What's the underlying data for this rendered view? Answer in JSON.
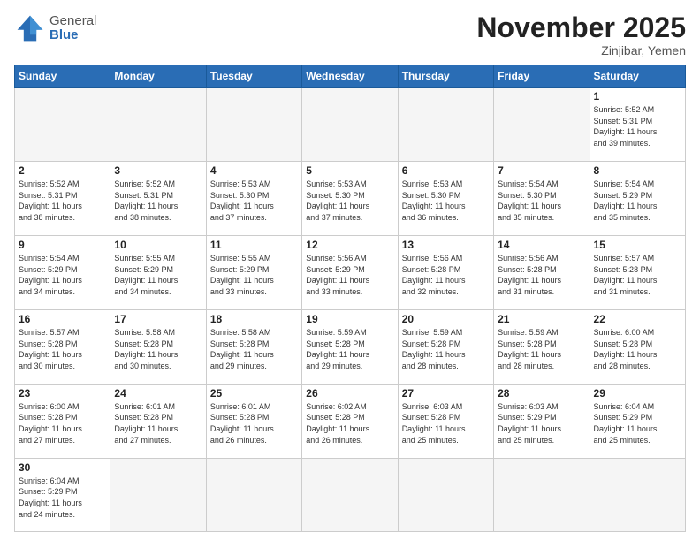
{
  "header": {
    "logo_general": "General",
    "logo_blue": "Blue",
    "month_title": "November 2025",
    "location": "Zinjibar, Yemen"
  },
  "weekdays": [
    "Sunday",
    "Monday",
    "Tuesday",
    "Wednesday",
    "Thursday",
    "Friday",
    "Saturday"
  ],
  "weeks": [
    [
      {
        "day": "",
        "info": ""
      },
      {
        "day": "",
        "info": ""
      },
      {
        "day": "",
        "info": ""
      },
      {
        "day": "",
        "info": ""
      },
      {
        "day": "",
        "info": ""
      },
      {
        "day": "",
        "info": ""
      },
      {
        "day": "1",
        "info": "Sunrise: 5:52 AM\nSunset: 5:31 PM\nDaylight: 11 hours\nand 39 minutes."
      }
    ],
    [
      {
        "day": "2",
        "info": "Sunrise: 5:52 AM\nSunset: 5:31 PM\nDaylight: 11 hours\nand 38 minutes."
      },
      {
        "day": "3",
        "info": "Sunrise: 5:52 AM\nSunset: 5:31 PM\nDaylight: 11 hours\nand 38 minutes."
      },
      {
        "day": "4",
        "info": "Sunrise: 5:53 AM\nSunset: 5:30 PM\nDaylight: 11 hours\nand 37 minutes."
      },
      {
        "day": "5",
        "info": "Sunrise: 5:53 AM\nSunset: 5:30 PM\nDaylight: 11 hours\nand 37 minutes."
      },
      {
        "day": "6",
        "info": "Sunrise: 5:53 AM\nSunset: 5:30 PM\nDaylight: 11 hours\nand 36 minutes."
      },
      {
        "day": "7",
        "info": "Sunrise: 5:54 AM\nSunset: 5:30 PM\nDaylight: 11 hours\nand 35 minutes."
      },
      {
        "day": "8",
        "info": "Sunrise: 5:54 AM\nSunset: 5:29 PM\nDaylight: 11 hours\nand 35 minutes."
      }
    ],
    [
      {
        "day": "9",
        "info": "Sunrise: 5:54 AM\nSunset: 5:29 PM\nDaylight: 11 hours\nand 34 minutes."
      },
      {
        "day": "10",
        "info": "Sunrise: 5:55 AM\nSunset: 5:29 PM\nDaylight: 11 hours\nand 34 minutes."
      },
      {
        "day": "11",
        "info": "Sunrise: 5:55 AM\nSunset: 5:29 PM\nDaylight: 11 hours\nand 33 minutes."
      },
      {
        "day": "12",
        "info": "Sunrise: 5:56 AM\nSunset: 5:29 PM\nDaylight: 11 hours\nand 33 minutes."
      },
      {
        "day": "13",
        "info": "Sunrise: 5:56 AM\nSunset: 5:28 PM\nDaylight: 11 hours\nand 32 minutes."
      },
      {
        "day": "14",
        "info": "Sunrise: 5:56 AM\nSunset: 5:28 PM\nDaylight: 11 hours\nand 31 minutes."
      },
      {
        "day": "15",
        "info": "Sunrise: 5:57 AM\nSunset: 5:28 PM\nDaylight: 11 hours\nand 31 minutes."
      }
    ],
    [
      {
        "day": "16",
        "info": "Sunrise: 5:57 AM\nSunset: 5:28 PM\nDaylight: 11 hours\nand 30 minutes."
      },
      {
        "day": "17",
        "info": "Sunrise: 5:58 AM\nSunset: 5:28 PM\nDaylight: 11 hours\nand 30 minutes."
      },
      {
        "day": "18",
        "info": "Sunrise: 5:58 AM\nSunset: 5:28 PM\nDaylight: 11 hours\nand 29 minutes."
      },
      {
        "day": "19",
        "info": "Sunrise: 5:59 AM\nSunset: 5:28 PM\nDaylight: 11 hours\nand 29 minutes."
      },
      {
        "day": "20",
        "info": "Sunrise: 5:59 AM\nSunset: 5:28 PM\nDaylight: 11 hours\nand 28 minutes."
      },
      {
        "day": "21",
        "info": "Sunrise: 5:59 AM\nSunset: 5:28 PM\nDaylight: 11 hours\nand 28 minutes."
      },
      {
        "day": "22",
        "info": "Sunrise: 6:00 AM\nSunset: 5:28 PM\nDaylight: 11 hours\nand 28 minutes."
      }
    ],
    [
      {
        "day": "23",
        "info": "Sunrise: 6:00 AM\nSunset: 5:28 PM\nDaylight: 11 hours\nand 27 minutes."
      },
      {
        "day": "24",
        "info": "Sunrise: 6:01 AM\nSunset: 5:28 PM\nDaylight: 11 hours\nand 27 minutes."
      },
      {
        "day": "25",
        "info": "Sunrise: 6:01 AM\nSunset: 5:28 PM\nDaylight: 11 hours\nand 26 minutes."
      },
      {
        "day": "26",
        "info": "Sunrise: 6:02 AM\nSunset: 5:28 PM\nDaylight: 11 hours\nand 26 minutes."
      },
      {
        "day": "27",
        "info": "Sunrise: 6:03 AM\nSunset: 5:28 PM\nDaylight: 11 hours\nand 25 minutes."
      },
      {
        "day": "28",
        "info": "Sunrise: 6:03 AM\nSunset: 5:29 PM\nDaylight: 11 hours\nand 25 minutes."
      },
      {
        "day": "29",
        "info": "Sunrise: 6:04 AM\nSunset: 5:29 PM\nDaylight: 11 hours\nand 25 minutes."
      }
    ],
    [
      {
        "day": "30",
        "info": "Sunrise: 6:04 AM\nSunset: 5:29 PM\nDaylight: 11 hours\nand 24 minutes."
      },
      {
        "day": "",
        "info": ""
      },
      {
        "day": "",
        "info": ""
      },
      {
        "day": "",
        "info": ""
      },
      {
        "day": "",
        "info": ""
      },
      {
        "day": "",
        "info": ""
      },
      {
        "day": "",
        "info": ""
      }
    ]
  ]
}
